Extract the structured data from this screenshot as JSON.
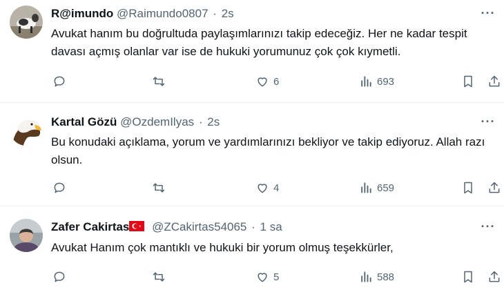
{
  "tweets": [
    {
      "name": "R@imundo",
      "handle": "@Raimundo0807",
      "separator": "·",
      "time": "2s",
      "flag": false,
      "avatar": "goat-avatar",
      "text": "Avukat hanım bu doğrultuda paylaşımlarınızı takip edeceğiz. Her ne kadar tespit davası açmış olanlar var ise de hukuki yorumunuz çok çok kıymetli.",
      "more_icon": "more-icon",
      "stats": {
        "replies": "",
        "retweets": "",
        "likes": "6",
        "views": "693"
      }
    },
    {
      "name": "Kartal Gözü",
      "handle": "@OzdemIlyas",
      "separator": "·",
      "time": "2s",
      "flag": false,
      "avatar": "eagle-avatar",
      "text": "Bu konudaki açıklama, yorum ve yardımlarınızı bekliyor ve takip ediyoruz. Allah razı olsun.",
      "more_icon": "more-icon",
      "stats": {
        "replies": "",
        "retweets": "",
        "likes": "4",
        "views": "659"
      }
    },
    {
      "name": "Zafer Cakirtas",
      "handle": "@ZCakirtas54065",
      "separator": "·",
      "time": "1 sa",
      "flag": true,
      "avatar": "person-avatar",
      "text": "Avukat Hanım çok mantıklı ve hukuki bir yorum olmuş teşekkürler,",
      "more_icon": "more-icon",
      "stats": {
        "replies": "",
        "retweets": "",
        "likes": "5",
        "views": "588"
      }
    }
  ],
  "colors": {
    "text": "#0f1419",
    "secondary": "#536471",
    "divider": "#eff3f4",
    "flag": "#e30a17"
  }
}
